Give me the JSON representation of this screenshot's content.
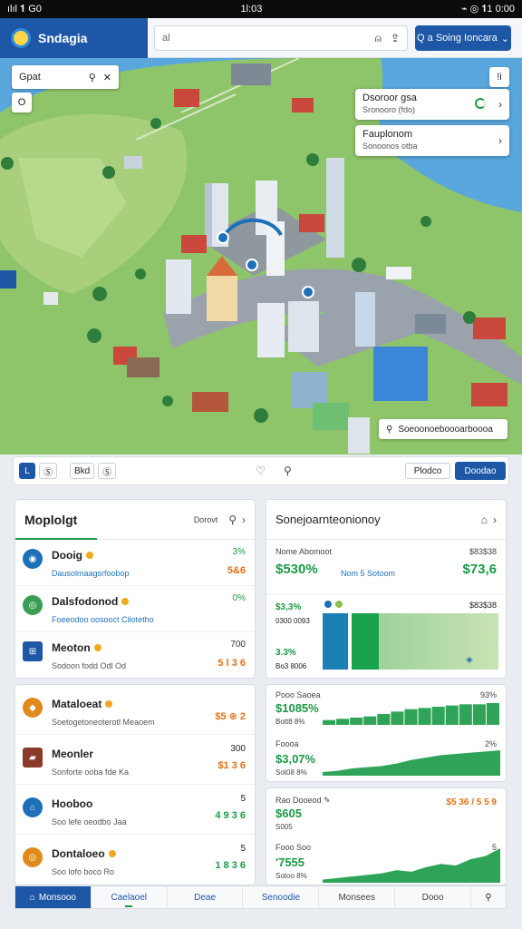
{
  "status_bar": {
    "left": "ılıl 𝟏 G0",
    "time": "1l:03",
    "right": "⌁ ◎ 𝟏1 0:00"
  },
  "header": {
    "app_name": "Sndagia",
    "search_placeholder": "al",
    "primary_label": "Q a Soing Ioncara"
  },
  "map": {
    "filter_text": "Gpat",
    "small_left_label": "O",
    "small_right_label": "!i",
    "cards": [
      {
        "title": "Dsoroor gsa",
        "subtitle": "Sronooro (fdo)"
      },
      {
        "title": "Fauplonom",
        "subtitle": "Sonoonos otba"
      }
    ],
    "legend_text": "Soeoonoeboooarboooa"
  },
  "toolbar": {
    "buttons": [
      "L",
      "Ⓢ",
      "Bkd",
      "Ⓢ"
    ],
    "outline_label": "Plodco",
    "primary_label": "Doodao"
  },
  "left_panel_a": {
    "title": "Moplolgt",
    "header_link": "Dorovt",
    "items": [
      {
        "name": "Dooig",
        "sub": "Dausolmaagsrfoobop",
        "v1": "3%",
        "v2": "5&6",
        "color": "#1d6fb8"
      },
      {
        "name": "Dalsfodonod",
        "sub": "Foeeodoo oosooct Cilotetho",
        "v1": "0%",
        "v2": "",
        "color": "#3c9e55"
      },
      {
        "name": "Meoton",
        "sub": "Sodoon fodd Odl Od",
        "v1": "700",
        "v2": "5 l 3 6",
        "color": "#1d57a6"
      }
    ]
  },
  "left_panel_b": {
    "items": [
      {
        "name": "Mataloeat",
        "sub": "Soetogetoneoterotl Meaoem",
        "v1": "",
        "v2": "$5 ⊕ 2",
        "color": "#e08a1e"
      },
      {
        "name": "Meonler",
        "sub": "Sonforte ooba fde Ka",
        "v1": "300",
        "v2": "$1 3 6",
        "color": "#8b3a2a"
      },
      {
        "name": "Hooboo",
        "sub": "Soo lefe oeodbo Jaa",
        "v1": "5",
        "v2": "4 9 3 6",
        "color": "#1d6fb8"
      },
      {
        "name": "Dontaloeo",
        "sub": "Soo lofo boco Ro",
        "v1": "5",
        "v2": "1 8 3 6",
        "color": "#e08a1e"
      }
    ]
  },
  "right_panel_a": {
    "title": "Sonejoarnteonionoy",
    "stat_label": "Nome Abomoot",
    "stat_big": "$530%",
    "stat_mid": "Nom 5 Sotoom",
    "stat_rlabel": "$83$38",
    "stat_rbig": "$73,6",
    "bar_top_left": "$3,3%",
    "bar_small_1": "0300 0093",
    "bar_mid_left": "3.3%",
    "bar_small_2": "Bo3 8006",
    "bar_right_label": "$83$38"
  },
  "right_panel_b": {
    "r1_label": "Pooo Saoea",
    "r1_big": "$1085%",
    "r1_small": "Bott8  8%",
    "r1_right": "93%",
    "r2_label": "Foooa",
    "r2_big": "$3,07%",
    "r2_small": "Sot08  8%",
    "r2_right": "2%"
  },
  "right_panel_c": {
    "r1_label": "Rao Dooeod ✎",
    "r1_big": "$605",
    "r1_small": "S005",
    "r1_right": "$5 36 / 5 5 9",
    "r2_label": "Fooo Soo",
    "r2_big": "'7555",
    "r2_small": "Sotoo  8%",
    "r2_right": "5"
  },
  "bottom_tabs": [
    "Monsooo",
    "Caelaoel",
    "Deae",
    "Senoodie",
    "Monsees",
    "Dooo"
  ],
  "colors": {
    "brand_blue": "#1d57a6",
    "accent_green": "#1a9a44",
    "accent_orange": "#e46f12"
  },
  "chart_data": [
    {
      "type": "area",
      "name": "growth-1",
      "values": [
        4,
        5,
        6,
        7,
        9,
        11,
        13,
        14,
        15,
        16,
        17,
        17,
        18
      ]
    },
    {
      "type": "area",
      "name": "growth-2",
      "values": [
        3,
        4,
        6,
        7,
        8,
        10,
        13,
        15,
        17,
        18,
        19,
        20,
        21
      ]
    },
    {
      "type": "area",
      "name": "growth-3",
      "values": [
        2,
        3,
        4,
        5,
        6,
        8,
        7,
        10,
        12,
        11,
        15,
        17,
        22
      ]
    }
  ]
}
